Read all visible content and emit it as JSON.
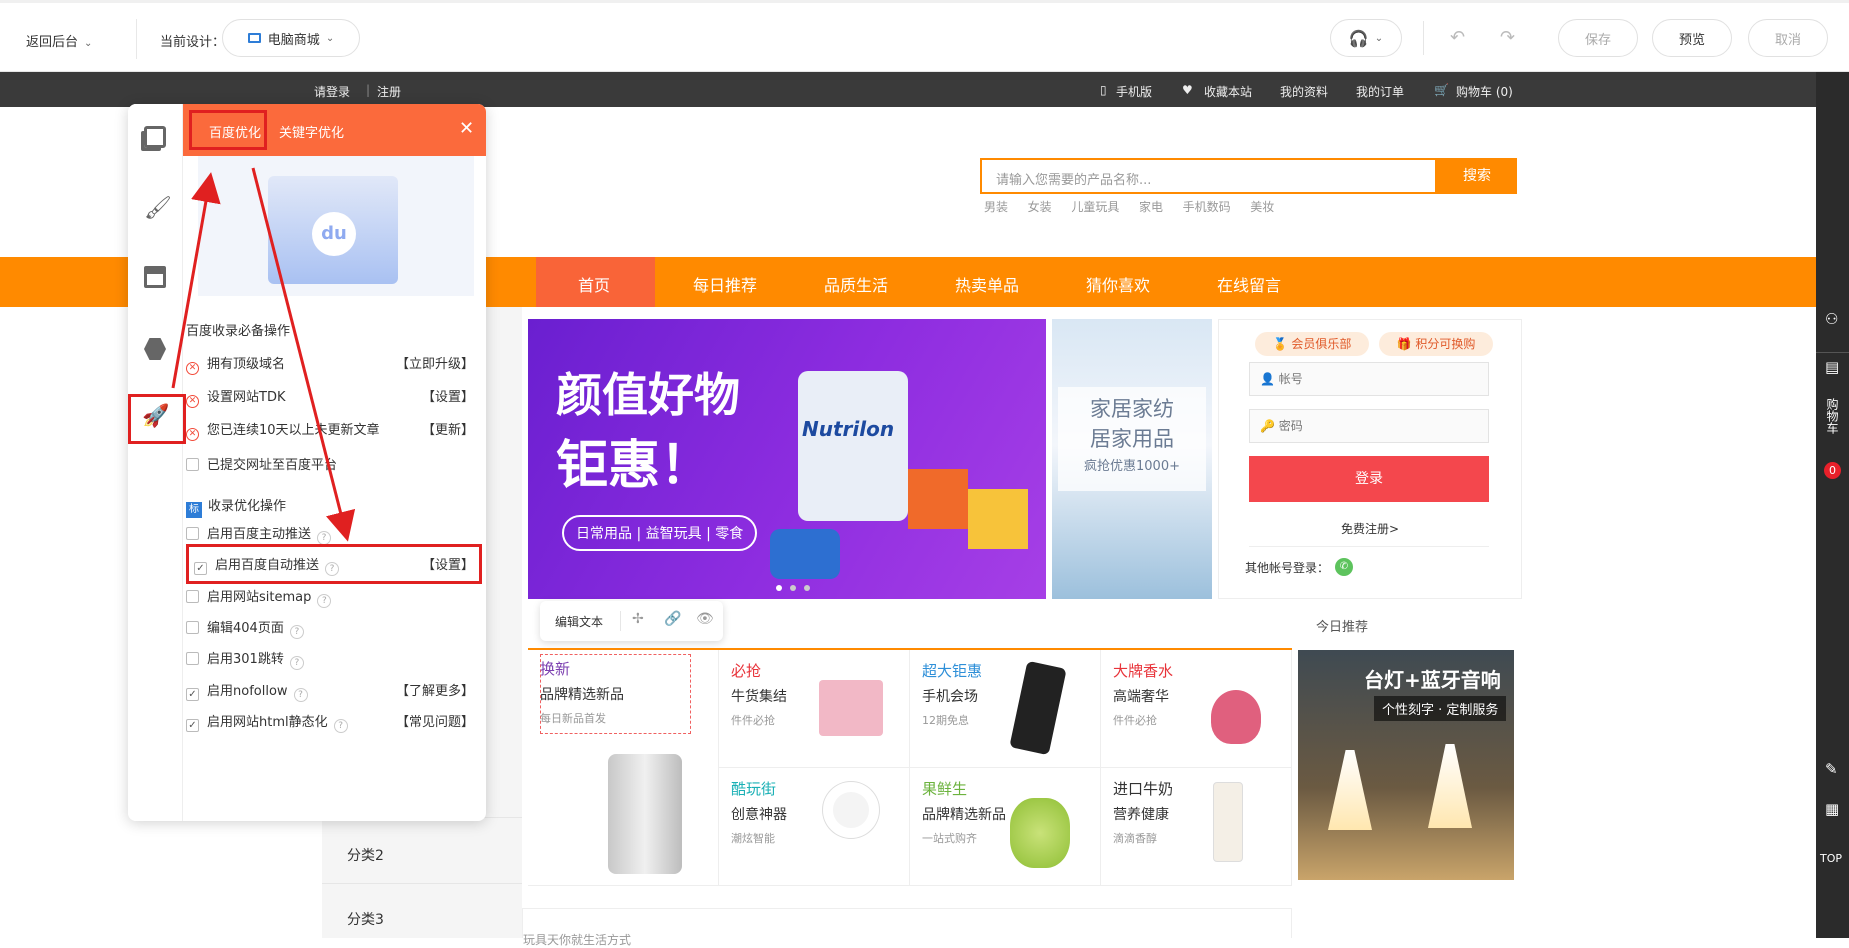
{
  "editor": {
    "back_label": "返回后台",
    "current_design_label": "当前设计：",
    "design_name": "电脑商城",
    "save": "保存",
    "preview": "预览",
    "cancel": "取消"
  },
  "site_top": {
    "login": "请登录",
    "register": "注册",
    "mobile": "手机版",
    "favorite": "收藏本站",
    "profile": "我的资料",
    "orders": "我的订单",
    "cart": "购物车 (0)"
  },
  "search": {
    "placeholder": "请输入您需要的产品名称...",
    "button": "搜索",
    "hot": [
      "男装",
      "女装",
      "儿童玩具",
      "家电",
      "手机数码",
      "美妆"
    ]
  },
  "nav": [
    "首页",
    "每日推荐",
    "品质生活",
    "热卖单品",
    "猜你喜欢",
    "在线留言"
  ],
  "panel": {
    "tab_baidu": "百度优化",
    "tab_keyword": "关键字优化",
    "section1_title": "百度收录必备操作",
    "required": [
      {
        "label": "拥有顶级域名",
        "action": "【立即升级】"
      },
      {
        "label": "设置网站TDK",
        "action": "【设置】"
      },
      {
        "label": "您已连续10天以上未更新文章",
        "action": "【更新】"
      }
    ],
    "submitted_label": "已提交网址至百度平台",
    "section2_badge": "标",
    "section2_title": "收录优化操作",
    "options": [
      {
        "label": "启用百度主动推送",
        "checked": false,
        "action": ""
      },
      {
        "label": "启用百度自动推送",
        "checked": true,
        "action": "【设置】"
      },
      {
        "label": "启用网站sitemap",
        "checked": false,
        "action": ""
      },
      {
        "label": "编辑404页面",
        "checked": false,
        "action": ""
      },
      {
        "label": "启用301跳转",
        "checked": false,
        "action": ""
      },
      {
        "label": "启用nofollow",
        "checked": true,
        "action": "【了解更多】"
      },
      {
        "label": "启用网站html静态化",
        "checked": true,
        "action": "【常见问题】"
      }
    ]
  },
  "banner": {
    "headline1": "颜值好物",
    "headline2": "钜惠！",
    "sub": "日常用品 | 益智玩具 | 零食",
    "brand": "Nutrilon",
    "side_title1": "家居家纺",
    "side_title2": "居家用品",
    "side_sub": "疯抢优惠1000+"
  },
  "login": {
    "club": "会员俱乐部",
    "points": "积分可换购",
    "account_ph": "帐号",
    "password_ph": "密码",
    "login_btn": "登录",
    "free_register": "免费注册>",
    "other": "其他帐号登录："
  },
  "toolbar": {
    "edit_text": "编辑文本"
  },
  "today_label": "今日推荐",
  "products": [
    {
      "title": "换新",
      "sub": "品牌精选新品",
      "desc": "每日新品首发",
      "color": "#7b3fb0"
    },
    {
      "title": "必抢",
      "sub": "牛货集结",
      "desc": "件件必抢",
      "color": "#e8333a"
    },
    {
      "title": "超大钜惠",
      "sub": "手机会场",
      "desc": "12期免息",
      "color": "#2e8fd8"
    },
    {
      "title": "大牌香水",
      "sub": "高端奢华",
      "desc": "件件必抢",
      "color": "#e8333a"
    },
    {
      "title": "酷玩街",
      "sub": "创意神器",
      "desc": "潮炫智能",
      "color": "#1ab0b5"
    },
    {
      "title": "果鲜生",
      "sub": "品牌精选新品",
      "desc": "一站式购齐",
      "color": "#6cb33e"
    },
    {
      "title": "进口牛奶",
      "sub": "营养健康",
      "desc": "滴滴香醇",
      "color": "#333333"
    }
  ],
  "lamp": {
    "title": "台灯+蓝牙音响",
    "sub": "个性刻字 · 定制服务"
  },
  "categories": [
    "分类2",
    "分类3"
  ],
  "rail": {
    "cart": "购物车",
    "cart_count": "0",
    "top": "TOP"
  },
  "bottom_text": "玩具天你就生活方式"
}
